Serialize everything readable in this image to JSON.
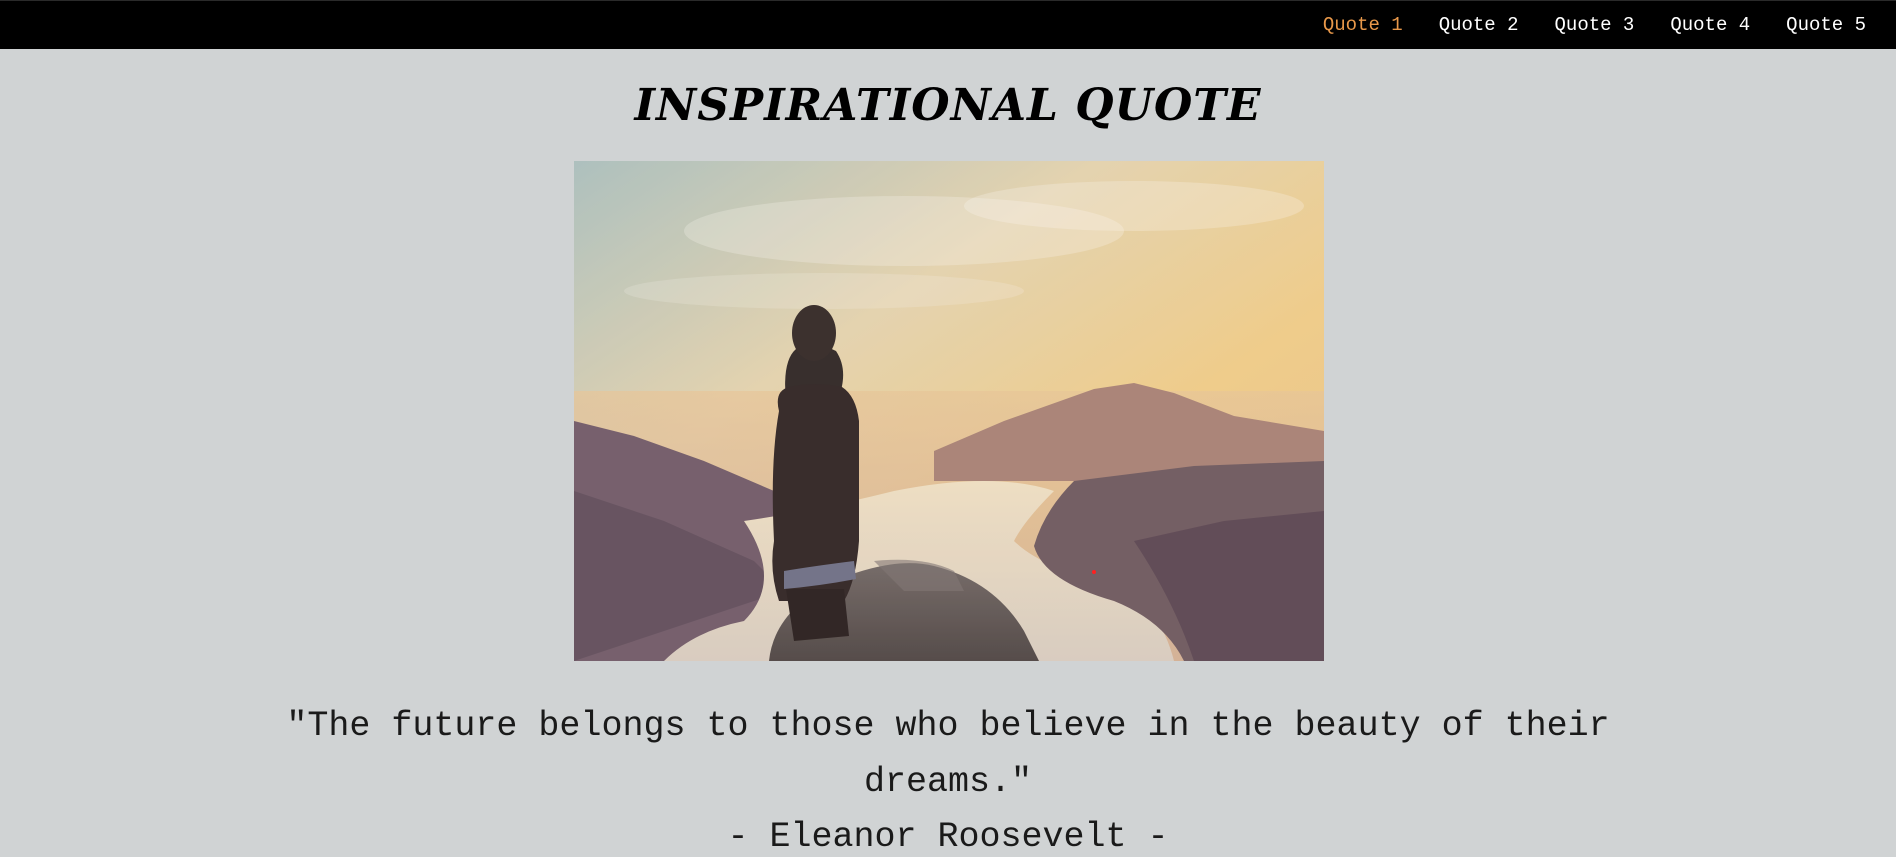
{
  "nav": {
    "items": [
      {
        "label": "Quote 1",
        "active": true
      },
      {
        "label": "Quote 2",
        "active": false
      },
      {
        "label": "Quote 3",
        "active": false
      },
      {
        "label": "Quote 4",
        "active": false
      },
      {
        "label": "Quote 5",
        "active": false
      }
    ]
  },
  "page": {
    "title": "INSPIRATIONAL QUOTE"
  },
  "quote": {
    "text": "\"The future belongs to those who believe in the beauty of their dreams.\"",
    "author": "- Eleanor Roosevelt -"
  },
  "colors": {
    "background": "#d0d3d4",
    "navbar": "#000000",
    "nav_text": "#ffffff",
    "nav_active": "#e8984a",
    "text": "#1a1a1a"
  }
}
